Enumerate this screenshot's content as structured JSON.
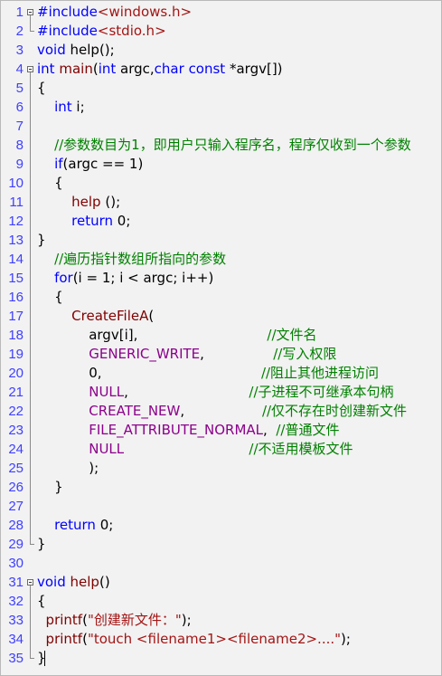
{
  "editor": {
    "lines": [
      {
        "n": "1",
        "t": [
          {
            "c": "pp",
            "s": "#include"
          },
          {
            "c": "hdr",
            "s": "<windows.h>"
          }
        ]
      },
      {
        "n": "2",
        "t": [
          {
            "c": "pp",
            "s": "#include"
          },
          {
            "c": "hdr",
            "s": "<stdio.h>"
          }
        ]
      },
      {
        "n": "3",
        "t": [
          {
            "c": "kw",
            "s": "void"
          },
          {
            "c": "",
            "s": " help();"
          }
        ]
      },
      {
        "n": "4",
        "t": [
          {
            "c": "kw",
            "s": "int"
          },
          {
            "c": "",
            "s": " "
          },
          {
            "c": "fn",
            "s": "main"
          },
          {
            "c": "",
            "s": "("
          },
          {
            "c": "kw",
            "s": "int"
          },
          {
            "c": "",
            "s": " argc,"
          },
          {
            "c": "kw",
            "s": "char"
          },
          {
            "c": "",
            "s": " "
          },
          {
            "c": "kw",
            "s": "const"
          },
          {
            "c": "",
            "s": " *argv[])"
          }
        ]
      },
      {
        "n": "5",
        "t": [
          {
            "c": "",
            "s": "{"
          }
        ]
      },
      {
        "n": "6",
        "t": [
          {
            "c": "",
            "s": "    "
          },
          {
            "c": "kw",
            "s": "int"
          },
          {
            "c": "",
            "s": " i;"
          }
        ]
      },
      {
        "n": "7",
        "t": []
      },
      {
        "n": "8",
        "t": [
          {
            "c": "",
            "s": "    "
          },
          {
            "c": "cm",
            "s": "//参数数目为1，即用户只输入程序名，程序仅收到一个参数"
          }
        ]
      },
      {
        "n": "9",
        "t": [
          {
            "c": "",
            "s": "    "
          },
          {
            "c": "kw",
            "s": "if"
          },
          {
            "c": "",
            "s": "(argc == 1)"
          }
        ]
      },
      {
        "n": "10",
        "t": [
          {
            "c": "",
            "s": "    {"
          }
        ]
      },
      {
        "n": "11",
        "t": [
          {
            "c": "",
            "s": "        "
          },
          {
            "c": "fn",
            "s": "help"
          },
          {
            "c": "",
            "s": " ();"
          }
        ]
      },
      {
        "n": "12",
        "t": [
          {
            "c": "",
            "s": "        "
          },
          {
            "c": "kw",
            "s": "return"
          },
          {
            "c": "",
            "s": " 0;"
          }
        ]
      },
      {
        "n": "13",
        "t": [
          {
            "c": "",
            "s": "}"
          }
        ]
      },
      {
        "n": "14",
        "t": [
          {
            "c": "",
            "s": "    "
          },
          {
            "c": "cm",
            "s": "//遍历指针数组所指向的参数"
          }
        ]
      },
      {
        "n": "15",
        "t": [
          {
            "c": "",
            "s": "    "
          },
          {
            "c": "kw",
            "s": "for"
          },
          {
            "c": "",
            "s": "(i = 1; i < argc; i++)"
          }
        ]
      },
      {
        "n": "16",
        "t": [
          {
            "c": "",
            "s": "    {"
          }
        ]
      },
      {
        "n": "17",
        "t": [
          {
            "c": "",
            "s": "        "
          },
          {
            "c": "fn",
            "s": "CreateFileA"
          },
          {
            "c": "",
            "s": "("
          }
        ]
      },
      {
        "n": "18",
        "t": [
          {
            "c": "",
            "s": "            argv[i],                              "
          },
          {
            "c": "cm",
            "s": "//文件名"
          }
        ]
      },
      {
        "n": "19",
        "t": [
          {
            "c": "",
            "s": "            "
          },
          {
            "c": "mac",
            "s": "GENERIC_WRITE"
          },
          {
            "c": "",
            "s": ",                "
          },
          {
            "c": "cm",
            "s": "//写入权限"
          }
        ]
      },
      {
        "n": "20",
        "t": [
          {
            "c": "",
            "s": "            0,                                     "
          },
          {
            "c": "cm",
            "s": "//阻止其他进程访问"
          }
        ]
      },
      {
        "n": "21",
        "t": [
          {
            "c": "",
            "s": "            "
          },
          {
            "c": "mac",
            "s": "NULL"
          },
          {
            "c": "",
            "s": ",                            "
          },
          {
            "c": "cm",
            "s": "//子进程不可继承本句柄"
          }
        ]
      },
      {
        "n": "22",
        "t": [
          {
            "c": "",
            "s": "            "
          },
          {
            "c": "mac",
            "s": "CREATE_NEW"
          },
          {
            "c": "",
            "s": ",                  "
          },
          {
            "c": "cm",
            "s": "//仅不存在时创建新文件"
          }
        ]
      },
      {
        "n": "23",
        "t": [
          {
            "c": "",
            "s": "            "
          },
          {
            "c": "mac",
            "s": "FILE_ATTRIBUTE_NORMAL"
          },
          {
            "c": "",
            "s": ",  "
          },
          {
            "c": "cm",
            "s": "//普通文件"
          }
        ]
      },
      {
        "n": "24",
        "t": [
          {
            "c": "",
            "s": "            "
          },
          {
            "c": "mac",
            "s": "NULL"
          },
          {
            "c": "",
            "s": "                             "
          },
          {
            "c": "cm",
            "s": "//不适用模板文件"
          }
        ]
      },
      {
        "n": "25",
        "t": [
          {
            "c": "",
            "s": "            );"
          }
        ]
      },
      {
        "n": "26",
        "t": [
          {
            "c": "",
            "s": "    }"
          }
        ]
      },
      {
        "n": "27",
        "t": []
      },
      {
        "n": "28",
        "t": [
          {
            "c": "",
            "s": "    "
          },
          {
            "c": "kw",
            "s": "return"
          },
          {
            "c": "",
            "s": " 0;"
          }
        ]
      },
      {
        "n": "29",
        "t": [
          {
            "c": "",
            "s": "}"
          }
        ]
      },
      {
        "n": "30",
        "t": []
      },
      {
        "n": "31",
        "t": [
          {
            "c": "kw",
            "s": "void"
          },
          {
            "c": "",
            "s": " "
          },
          {
            "c": "fn",
            "s": "help"
          },
          {
            "c": "",
            "s": "()"
          }
        ]
      },
      {
        "n": "32",
        "t": [
          {
            "c": "",
            "s": "{"
          }
        ]
      },
      {
        "n": "33",
        "t": [
          {
            "c": "",
            "s": "  "
          },
          {
            "c": "fn",
            "s": "printf"
          },
          {
            "c": "",
            "s": "("
          },
          {
            "c": "str",
            "s": "\"创建新文件：\""
          },
          {
            "c": "",
            "s": ");"
          }
        ]
      },
      {
        "n": "34",
        "t": [
          {
            "c": "",
            "s": "  "
          },
          {
            "c": "fn",
            "s": "printf"
          },
          {
            "c": "",
            "s": "("
          },
          {
            "c": "str",
            "s": "\"touch <filename1><filename2>....\""
          },
          {
            "c": "",
            "s": ");"
          }
        ]
      },
      {
        "n": "35",
        "t": [
          {
            "c": "",
            "s": "}"
          }
        ]
      }
    ],
    "fold_markers": [
      "1",
      "4",
      "31"
    ],
    "colors": {
      "keyword": "#0000ff",
      "comment": "#008000",
      "string": "#a31515",
      "macro": "#8b008b",
      "line_number": "#3f3fff",
      "background": "#f2f2f2"
    }
  }
}
